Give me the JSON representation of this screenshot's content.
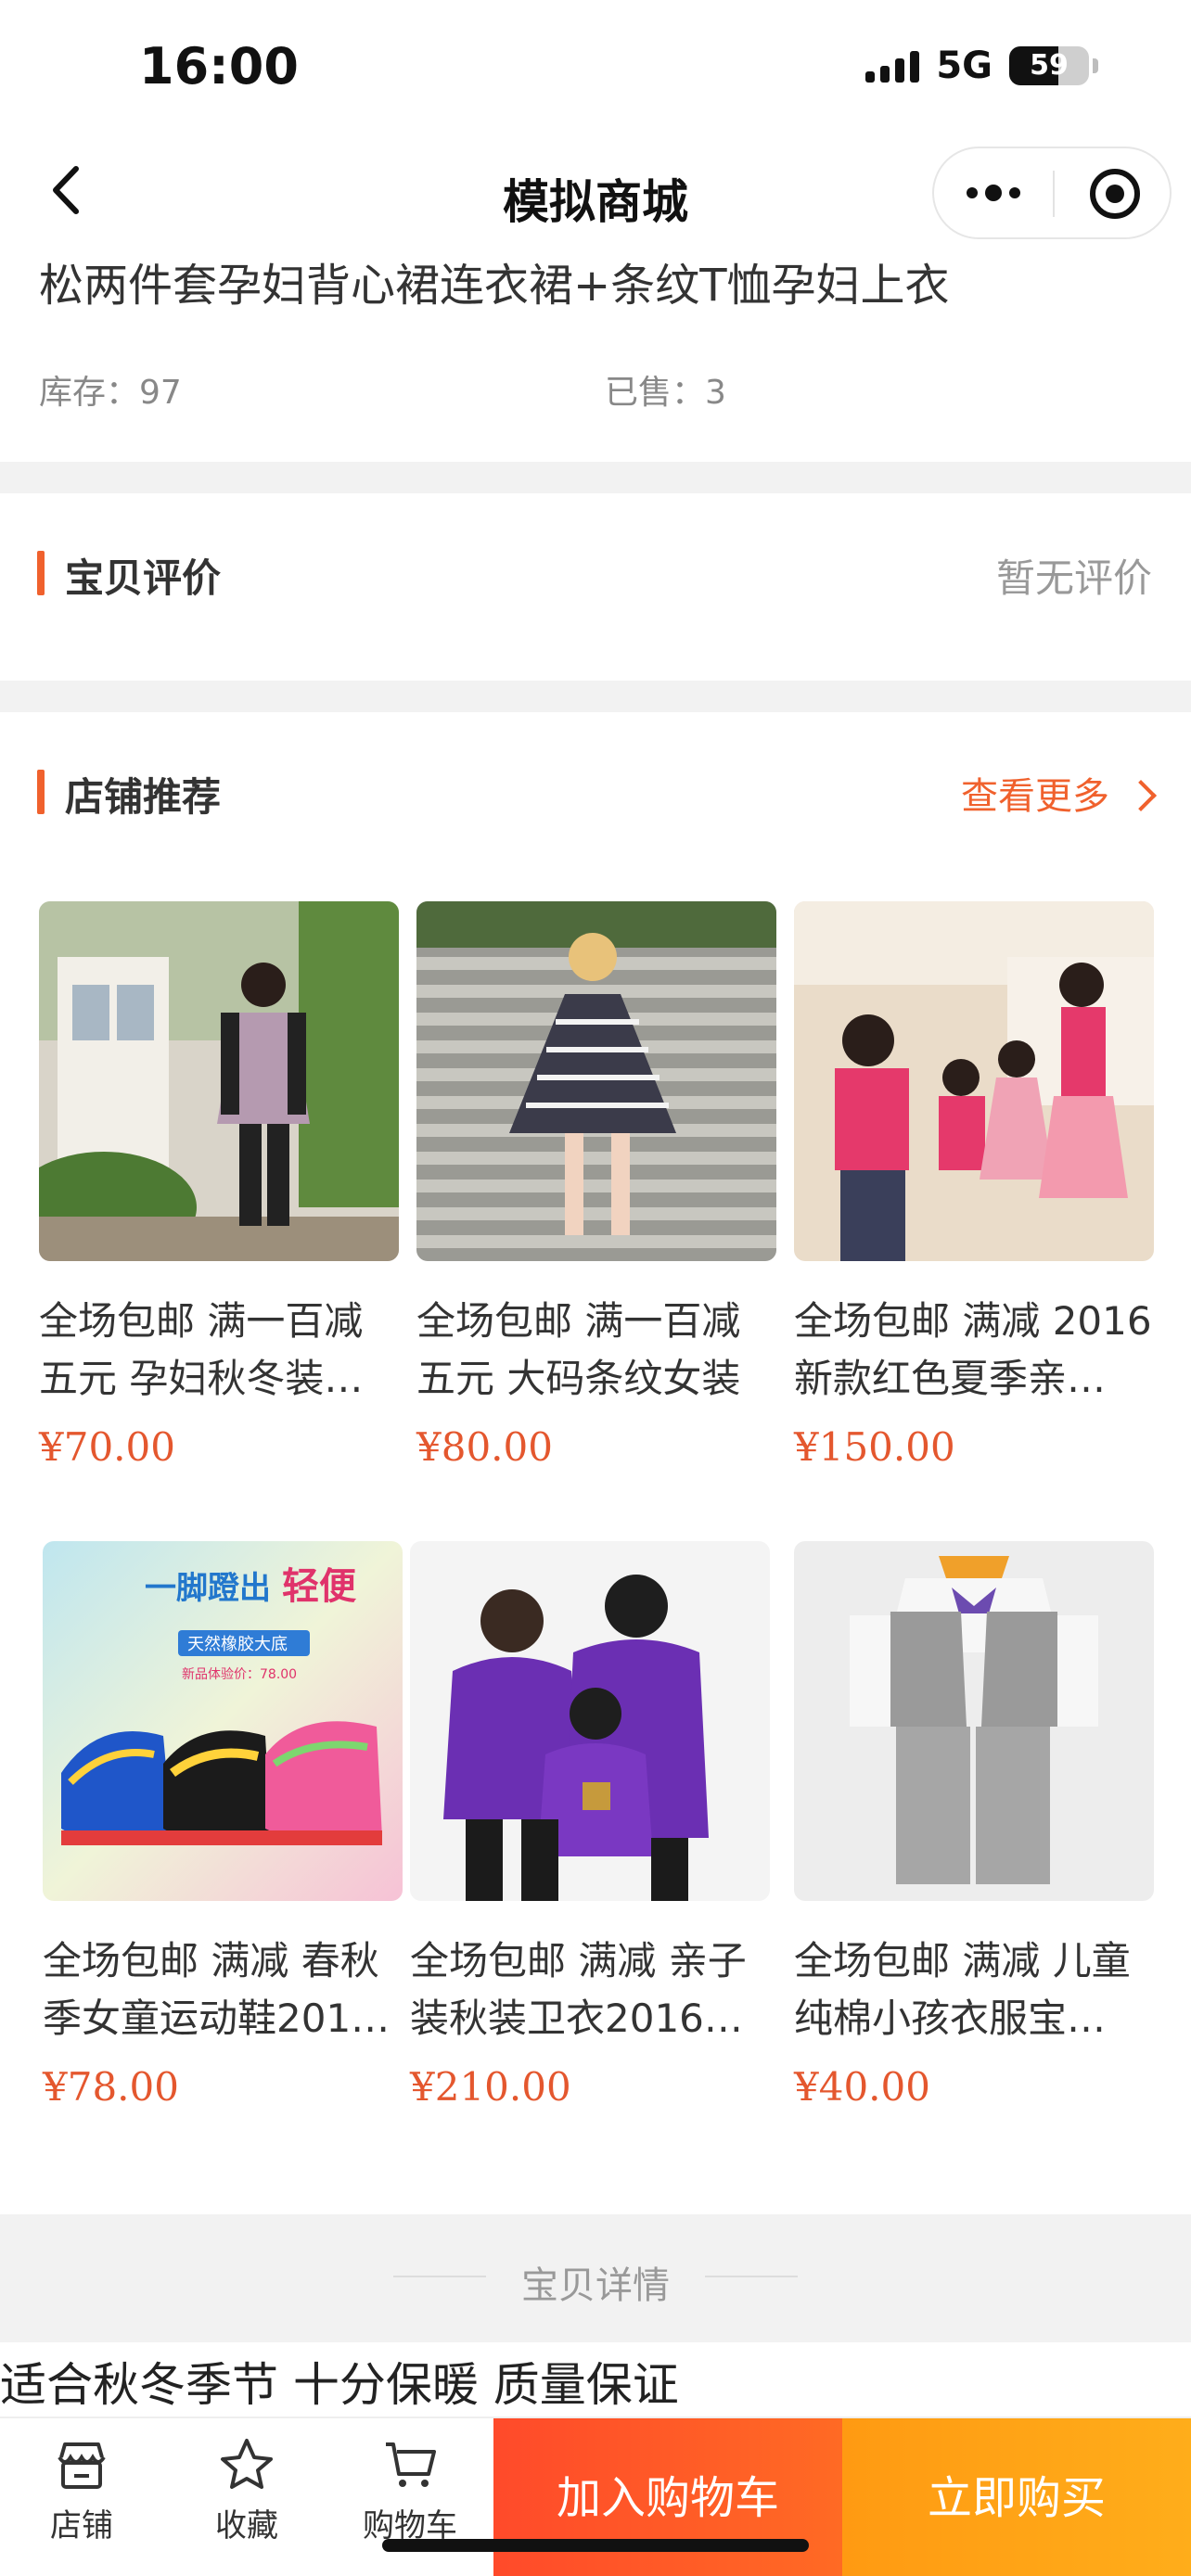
{
  "status_bar": {
    "time": "16:00",
    "network": "5G",
    "battery": "59"
  },
  "nav": {
    "title": "模拟商城"
  },
  "product": {
    "title": "松两件套孕妇背心裙连衣裙+条纹T恤孕妇上衣",
    "stock": "库存：97",
    "sold": "已售：3"
  },
  "reviews": {
    "title": "宝贝评价",
    "empty_text": "暂无评价"
  },
  "recommend": {
    "title": "店铺推荐",
    "more_label": "查看更多",
    "items": [
      {
        "name": "全场包邮 满一百减五元 孕妇秋冬装…",
        "price": "¥70.00"
      },
      {
        "name": "全场包邮 满一百减五元 大码条纹女装",
        "price": "¥80.00"
      },
      {
        "name": "全场包邮 满减 2016新款红色夏季亲…",
        "price": "¥150.00"
      },
      {
        "name": "全场包邮 满减 春秋季女童运动鞋201…",
        "price": "¥78.00"
      },
      {
        "name": "全场包邮 满减 亲子装秋装卫衣2016…",
        "price": "¥210.00"
      },
      {
        "name": "全场包邮 满减 儿童纯棉小孩衣服宝…",
        "price": "¥40.00"
      }
    ],
    "image_texts": {
      "shoe_headline_1": "一脚蹬出",
      "shoe_headline_2": "轻便",
      "shoe_tag": "天然橡胶大底",
      "shoe_price": "新品体验价：78.00"
    }
  },
  "details": {
    "label": "宝贝详情",
    "text": "适合秋冬季节  十分保暖  质量保证"
  },
  "bottom": {
    "shop": "店铺",
    "favorite": "收藏",
    "cart": "购物车",
    "add_to_cart": "加入购物车",
    "buy_now": "立即购买"
  },
  "colors": {
    "accent": "#f0612d",
    "price": "#e4572e",
    "cart_button": "#ff5327",
    "buy_button": "#ffa315"
  }
}
